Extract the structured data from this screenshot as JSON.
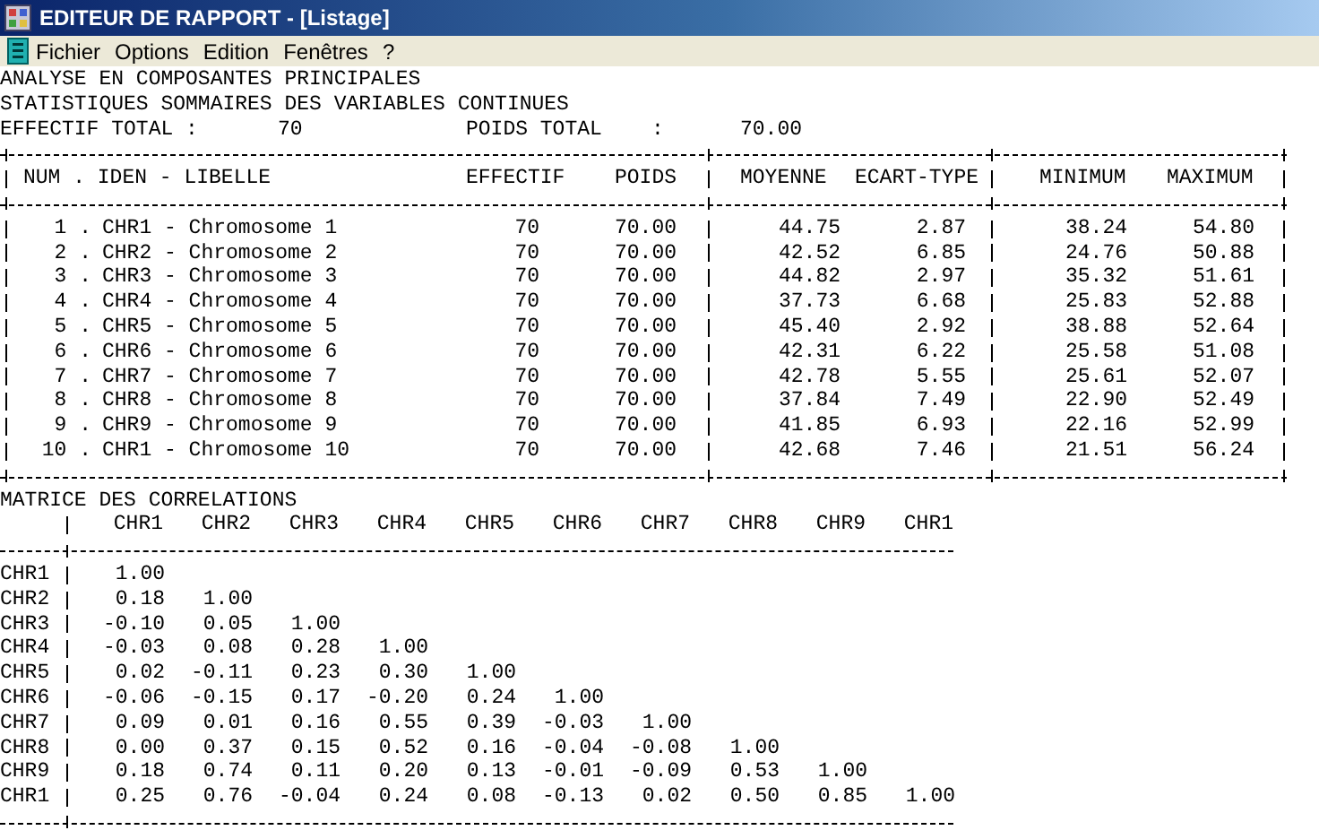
{
  "window": {
    "title": "EDITEUR DE RAPPORT - [Listage]"
  },
  "menu": [
    "Fichier",
    "Options",
    "Edition",
    "Fenêtres",
    "?"
  ],
  "report": {
    "lines": [
      "ANALYSE EN COMPOSANTES PRINCIPALES",
      "STATISTIQUES SOMMAIRES DES VARIABLES CONTINUES"
    ],
    "totals": {
      "effectif_label": "EFFECTIF TOTAL :",
      "effectif": "70",
      "poids_label": "POIDS TOTAL    :",
      "poids": "70.00"
    }
  },
  "stats_table": {
    "columns": [
      "NUM . IDEN - LIBELLE",
      "EFFECTIF",
      "POIDS",
      "MOYENNE",
      "ECART-TYPE",
      "MINIMUM",
      "MAXIMUM"
    ],
    "rows": [
      {
        "num": "1 .",
        "label": "CHR1 - Chromosome 1",
        "effectif": "70",
        "poids": "70.00",
        "moyenne": "44.75",
        "ecart_type": "2.87",
        "minimum": "38.24",
        "maximum": "54.80"
      },
      {
        "num": "2 .",
        "label": "CHR2 - Chromosome 2",
        "effectif": "70",
        "poids": "70.00",
        "moyenne": "42.52",
        "ecart_type": "6.85",
        "minimum": "24.76",
        "maximum": "50.88"
      },
      {
        "num": "3 .",
        "label": "CHR3 - Chromosome 3",
        "effectif": "70",
        "poids": "70.00",
        "moyenne": "44.82",
        "ecart_type": "2.97",
        "minimum": "35.32",
        "maximum": "51.61"
      },
      {
        "num": "4 .",
        "label": "CHR4 - Chromosome 4",
        "effectif": "70",
        "poids": "70.00",
        "moyenne": "37.73",
        "ecart_type": "6.68",
        "minimum": "25.83",
        "maximum": "52.88"
      },
      {
        "num": "5 .",
        "label": "CHR5 - Chromosome 5",
        "effectif": "70",
        "poids": "70.00",
        "moyenne": "45.40",
        "ecart_type": "2.92",
        "minimum": "38.88",
        "maximum": "52.64"
      },
      {
        "num": "6 .",
        "label": "CHR6 - Chromosome 6",
        "effectif": "70",
        "poids": "70.00",
        "moyenne": "42.31",
        "ecart_type": "6.22",
        "minimum": "25.58",
        "maximum": "51.08"
      },
      {
        "num": "7 .",
        "label": "CHR7 - Chromosome 7",
        "effectif": "70",
        "poids": "70.00",
        "moyenne": "42.78",
        "ecart_type": "5.55",
        "minimum": "25.61",
        "maximum": "52.07"
      },
      {
        "num": "8 .",
        "label": "CHR8 - Chromosome 8",
        "effectif": "70",
        "poids": "70.00",
        "moyenne": "37.84",
        "ecart_type": "7.49",
        "minimum": "22.90",
        "maximum": "52.49"
      },
      {
        "num": "9 .",
        "label": "CHR9 - Chromosome 9",
        "effectif": "70",
        "poids": "70.00",
        "moyenne": "41.85",
        "ecart_type": "6.93",
        "minimum": "22.16",
        "maximum": "52.99"
      },
      {
        "num": "10 .",
        "label": "CHR1 - Chromosome 10",
        "effectif": "70",
        "poids": "70.00",
        "moyenne": "42.68",
        "ecart_type": "7.46",
        "minimum": "21.51",
        "maximum": "56.24"
      }
    ]
  },
  "correlations": {
    "title": "MATRICE DES CORRELATIONS",
    "columns": [
      "CHR1",
      "CHR2",
      "CHR3",
      "CHR4",
      "CHR5",
      "CHR6",
      "CHR7",
      "CHR8",
      "CHR9",
      "CHR1"
    ],
    "rows": [
      {
        "label": "CHR1",
        "values": [
          "1.00"
        ]
      },
      {
        "label": "CHR2",
        "values": [
          "0.18",
          "1.00"
        ]
      },
      {
        "label": "CHR3",
        "values": [
          "-0.10",
          "0.05",
          "1.00"
        ]
      },
      {
        "label": "CHR4",
        "values": [
          "-0.03",
          "0.08",
          "0.28",
          "1.00"
        ]
      },
      {
        "label": "CHR5",
        "values": [
          "0.02",
          "-0.11",
          "0.23",
          "0.30",
          "1.00"
        ]
      },
      {
        "label": "CHR6",
        "values": [
          "-0.06",
          "-0.15",
          "0.17",
          "-0.20",
          "0.24",
          "1.00"
        ]
      },
      {
        "label": "CHR7",
        "values": [
          "0.09",
          "0.01",
          "0.16",
          "0.55",
          "0.39",
          "-0.03",
          "1.00"
        ]
      },
      {
        "label": "CHR8",
        "values": [
          "0.00",
          "0.37",
          "0.15",
          "0.52",
          "0.16",
          "-0.04",
          "-0.08",
          "1.00"
        ]
      },
      {
        "label": "CHR9",
        "values": [
          "0.18",
          "0.74",
          "0.11",
          "0.20",
          "0.13",
          "-0.01",
          "-0.09",
          "0.53",
          "1.00"
        ]
      },
      {
        "label": "CHR1",
        "values": [
          "0.25",
          "0.76",
          "-0.04",
          "0.24",
          "0.08",
          "-0.13",
          "0.02",
          "0.50",
          "0.85",
          "1.00"
        ]
      }
    ]
  }
}
